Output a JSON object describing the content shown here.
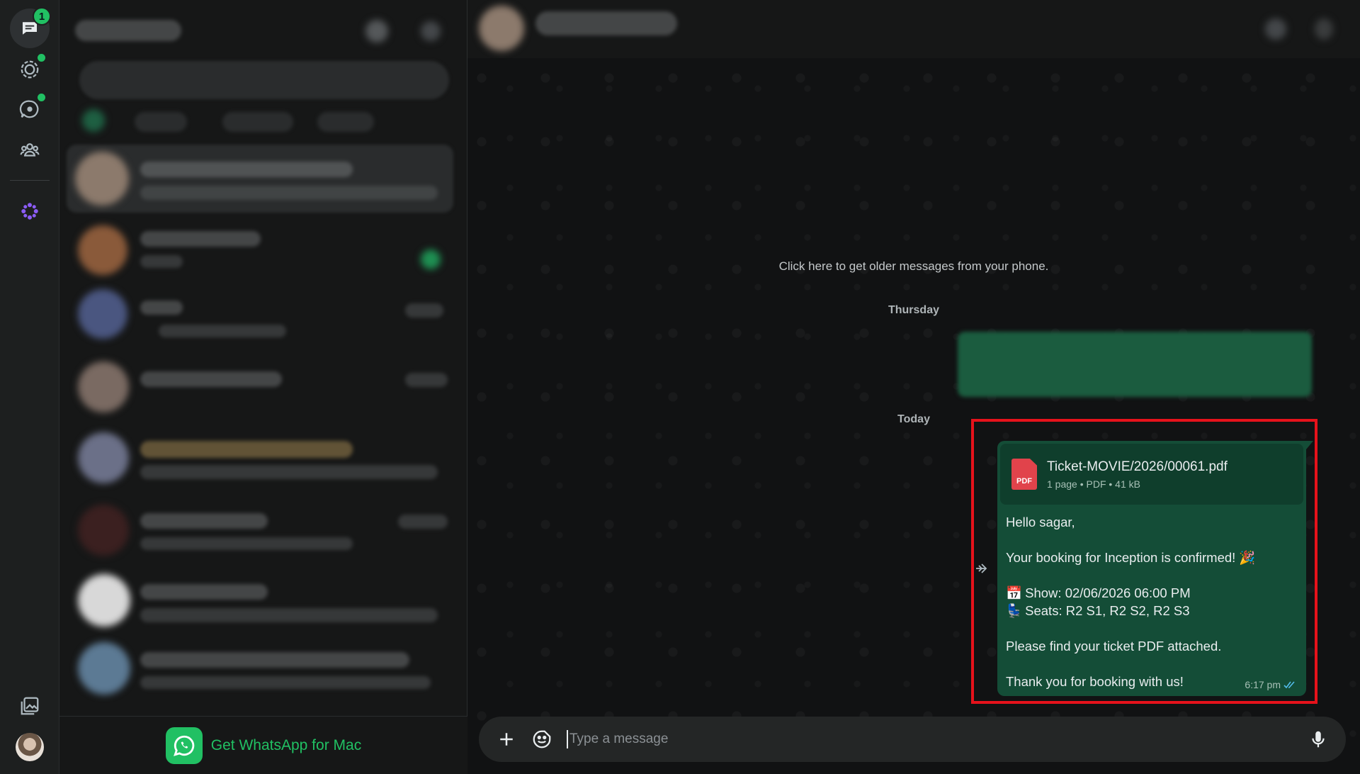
{
  "rail": {
    "chats_badge": "1",
    "icons": [
      "chats-icon",
      "status-icon",
      "channels-icon",
      "communities-icon",
      "meta-ai-icon",
      "media-icon",
      "profile-avatar"
    ]
  },
  "chatlist": {
    "get_app_label": "Get WhatsApp for Mac"
  },
  "conversation": {
    "older_messages_link": "Click here to get older messages from your phone.",
    "day_thursday": "Thursday",
    "day_today": "Today",
    "message": {
      "attachment_name": "Ticket-MOVIE/2026/00061.pdf",
      "attachment_meta": "1 page • PDF • 41 kB",
      "attachment_icon_label": "PDF",
      "greeting": "Hello sagar,",
      "confirmation": "Your booking for Inception is confirmed! 🎉",
      "show_line": "Show: 02/06/2026 06:00 PM",
      "seats_line": "Seats: R2 S1, R2 S2, R2 S3",
      "find_ticket": "Please find your ticket PDF attached.",
      "thanks": "Thank you for booking with us!",
      "time": "6:17 pm"
    }
  },
  "composer": {
    "placeholder": "Type a message"
  },
  "colors": {
    "accent": "#21c063",
    "outgoing_bubble": "#144d37",
    "highlight_border": "#e6121b"
  }
}
